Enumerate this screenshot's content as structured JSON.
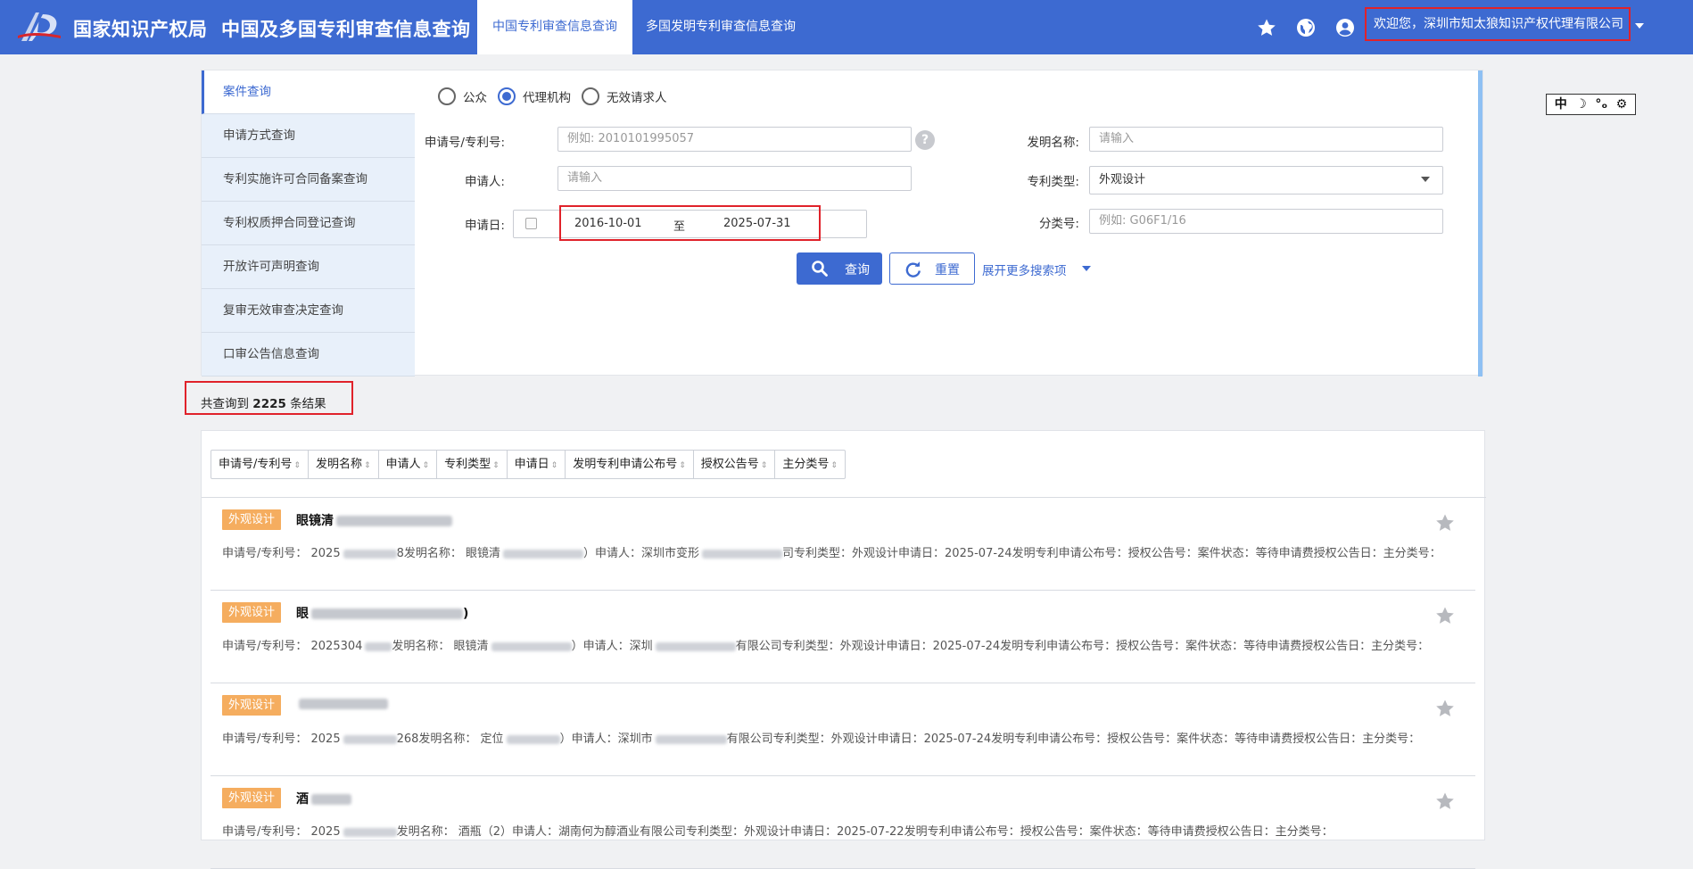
{
  "header": {
    "brand_primary": "国家知识产权局",
    "brand_secondary": "中国及多国专利审查信息查询",
    "tabs": [
      {
        "label": "中国专利审查信息查询",
        "active": true
      },
      {
        "label": "多国发明专利审查信息查询",
        "active": false
      }
    ],
    "icons": [
      "star-icon",
      "globe-icon",
      "account-icon"
    ],
    "welcome_text": "欢迎您，深圳市知太狼知识产权代理有限公司",
    "colors": {
      "bar": "#3d6ad1",
      "highlight": "#e0222a"
    }
  },
  "side_nav": {
    "items": [
      {
        "label": "案件查询",
        "active": true
      },
      {
        "label": "申请方式查询",
        "active": false
      },
      {
        "label": "专利实施许可合同备案查询",
        "active": false
      },
      {
        "label": "专利权质押合同登记查询",
        "active": false
      },
      {
        "label": "开放许可声明查询",
        "active": false
      },
      {
        "label": "复审无效审查决定查询",
        "active": false
      },
      {
        "label": "口审公告信息查询",
        "active": false
      }
    ]
  },
  "search": {
    "radios": [
      {
        "label": "公众",
        "checked": false
      },
      {
        "label": "代理机构",
        "checked": true
      },
      {
        "label": "无效请求人",
        "checked": false
      }
    ],
    "app_no_label": "申请号/专利号:",
    "app_no_placeholder": "例如: 2010101995057",
    "help_icon_glyph": "?",
    "invention_name_label": "发明名称:",
    "invention_name_placeholder": "请输入",
    "applicant_label": "申请人:",
    "applicant_placeholder": "请输入",
    "patent_type_label": "专利类型:",
    "patent_type_value": "外观设计",
    "filing_date_label": "申请日:",
    "date_from": "2016-10-01",
    "date_sep": "至",
    "date_to": "2025-07-31",
    "class_label": "分类号:",
    "class_placeholder": "例如:  G06F1/16",
    "search_button": "查询",
    "reset_button": "重置",
    "more_link": "展开更多搜索项"
  },
  "toolbox": {
    "items": [
      "中",
      "☽",
      "°ₒ",
      "⚙"
    ]
  },
  "results": {
    "count_prefix": "共查询到 ",
    "count": "2225",
    "count_suffix": " 条结果",
    "sort_columns": [
      "申请号/专利号",
      "发明名称",
      "申请人",
      "专利类型",
      "申请日",
      "发明专利申请公布号",
      "授权公告号",
      "主分类号"
    ],
    "sort_arrows": "⇕",
    "items": [
      {
        "badge": "外观设计",
        "title": "眼镜清",
        "detail_a": "申请号/专利号：  2025",
        "detail_b": "8发明名称：  眼镜清",
        "detail_c": "）申请人：深圳市变形",
        "detail_d": "司专利类型：外观设计申请日：2025-07-24发明专利申请公布号：授权公告号：案件状态：等待申请费授权公告日：主分类号："
      },
      {
        "badge": "外观设计",
        "title": "眼",
        "title_tail": ")",
        "detail_a": "申请号/专利号：  2025304",
        "detail_b": "发明名称：  眼镜清",
        "detail_c": "）申请人：深圳",
        "detail_d": "有限公司专利类型：外观设计申请日：2025-07-24发明专利申请公布号：授权公告号：案件状态：等待申请费授权公告日：主分类号："
      },
      {
        "badge": "外观设计",
        "title": "",
        "detail_a": "申请号/专利号：  2025",
        "detail_b": "268发明名称：  定位",
        "detail_c": "）申请人：深圳市",
        "detail_d": "有限公司专利类型：外观设计申请日：2025-07-24发明专利申请公布号：授权公告号：案件状态：等待申请费授权公告日：主分类号："
      },
      {
        "badge": "外观设计",
        "title": "酒",
        "detail_a": "申请号/专利号：  2025",
        "detail_b": "发明名称：  酒瓶（2）申请人：湖南何为醇酒业有限公司专利类型：外观设计申请日：2025-07-22发明专利申请公布号：授权公告号：案件状态：等待申请费授权公告日：主分类号：",
        "detail_c": "",
        "detail_d": ""
      }
    ]
  }
}
